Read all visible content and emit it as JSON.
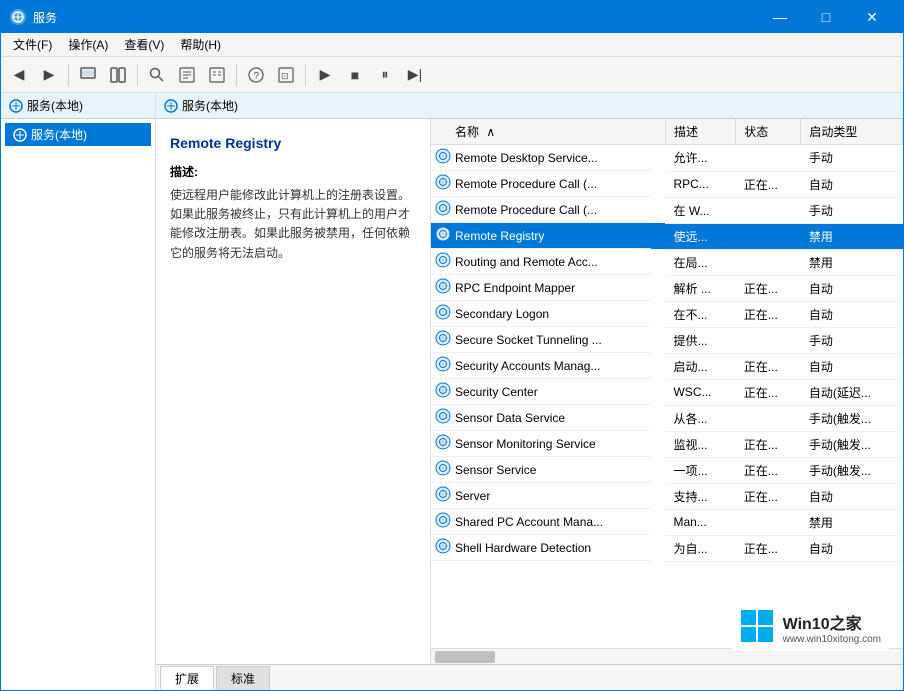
{
  "window": {
    "title": "服务",
    "controls": {
      "minimize": "—",
      "maximize": "□",
      "close": "✕"
    }
  },
  "menubar": {
    "items": [
      "文件(F)",
      "操作(A)",
      "查看(V)",
      "帮助(H)"
    ]
  },
  "toolbar": {
    "buttons": [
      "◀",
      "▶",
      "⊟",
      "⊡",
      "🔍",
      "📋",
      "📋",
      "❓",
      "📋",
      "▶",
      "■",
      "⏸",
      "▶|"
    ]
  },
  "left_panel": {
    "header": "服务(本地)",
    "tree_item": "服务(本地)"
  },
  "right_panel": {
    "header": "服务(本地)"
  },
  "description": {
    "title": "Remote Registry",
    "desc_label": "描述:",
    "desc_text": "使远程用户能修改此计算机上的注册表设置。如果此服务被终止，只有此计算机上的用户才能修改注册表。如果此服务被禁用，任何依赖它的服务将无法启动。"
  },
  "table": {
    "columns": [
      "名称",
      "描述",
      "状态",
      "启动类型"
    ],
    "rows": [
      {
        "name": "Remote Desktop Service...",
        "desc": "允许...",
        "status": "",
        "startup": "手动"
      },
      {
        "name": "Remote Procedure Call (...",
        "desc": "RPC...",
        "status": "正在...",
        "startup": "自动"
      },
      {
        "name": "Remote Procedure Call (...",
        "desc": "在 W...",
        "status": "",
        "startup": "手动"
      },
      {
        "name": "Remote Registry",
        "desc": "使远...",
        "status": "",
        "startup": "禁用",
        "selected": true
      },
      {
        "name": "Routing and Remote Acc...",
        "desc": "在局...",
        "status": "",
        "startup": "禁用"
      },
      {
        "name": "RPC Endpoint Mapper",
        "desc": "解析 ...",
        "status": "正在...",
        "startup": "自动"
      },
      {
        "name": "Secondary Logon",
        "desc": "在不...",
        "status": "正在...",
        "startup": "自动"
      },
      {
        "name": "Secure Socket Tunneling ...",
        "desc": "提供...",
        "status": "",
        "startup": "手动"
      },
      {
        "name": "Security Accounts Manag...",
        "desc": "启动...",
        "status": "正在...",
        "startup": "自动"
      },
      {
        "name": "Security Center",
        "desc": "WSC...",
        "status": "正在...",
        "startup": "自动(延迟..."
      },
      {
        "name": "Sensor Data Service",
        "desc": "从各...",
        "status": "",
        "startup": "手动(触发..."
      },
      {
        "name": "Sensor Monitoring Service",
        "desc": "监视...",
        "status": "正在...",
        "startup": "手动(触发..."
      },
      {
        "name": "Sensor Service",
        "desc": "一项...",
        "status": "正在...",
        "startup": "手动(触发..."
      },
      {
        "name": "Server",
        "desc": "支持...",
        "status": "正在...",
        "startup": "自动"
      },
      {
        "name": "Shared PC Account Mana...",
        "desc": "Man...",
        "status": "",
        "startup": "禁用"
      },
      {
        "name": "Shell Hardware Detection",
        "desc": "为自...",
        "status": "正在...",
        "startup": "自动"
      }
    ]
  },
  "tabs": [
    "扩展",
    "标准"
  ],
  "active_tab": "扩展",
  "watermark": {
    "line1": "Win10之家",
    "line2": "www.win10xitong.com"
  }
}
